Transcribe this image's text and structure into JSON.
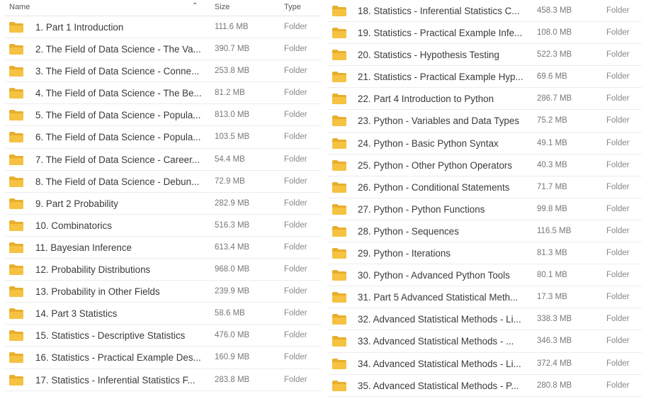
{
  "header": {
    "name": "Name",
    "size": "Size",
    "type": "Type",
    "sort_icon": "chevron-up-icon"
  },
  "colors": {
    "folder": "#F5C242",
    "folder_tab": "#E8AE2C"
  },
  "left_rows": [
    {
      "name": "1. Part 1 Introduction",
      "size": "111.6 MB",
      "type": "Folder"
    },
    {
      "name": "2. The Field of Data Science - The Va...",
      "size": "390.7 MB",
      "type": "Folder"
    },
    {
      "name": "3. The Field of Data Science - Conne...",
      "size": "253.8 MB",
      "type": "Folder"
    },
    {
      "name": "4. The Field of Data Science - The Be...",
      "size": "81.2 MB",
      "type": "Folder"
    },
    {
      "name": "5. The Field of Data Science - Popula...",
      "size": "813.0 MB",
      "type": "Folder"
    },
    {
      "name": "6. The Field of Data Science - Popula...",
      "size": "103.5 MB",
      "type": "Folder"
    },
    {
      "name": "7. The Field of Data Science - Career...",
      "size": "54.4 MB",
      "type": "Folder"
    },
    {
      "name": "8. The Field of Data Science - Debun...",
      "size": "72.9 MB",
      "type": "Folder"
    },
    {
      "name": "9. Part 2 Probability",
      "size": "282.9 MB",
      "type": "Folder"
    },
    {
      "name": "10. Combinatorics",
      "size": "516.3 MB",
      "type": "Folder"
    },
    {
      "name": "11. Bayesian Inference",
      "size": "613.4 MB",
      "type": "Folder"
    },
    {
      "name": "12. Probability Distributions",
      "size": "968.0 MB",
      "type": "Folder"
    },
    {
      "name": "13. Probability in Other Fields",
      "size": "239.9 MB",
      "type": "Folder"
    },
    {
      "name": "14. Part 3 Statistics",
      "size": "58.6 MB",
      "type": "Folder"
    },
    {
      "name": "15. Statistics - Descriptive Statistics",
      "size": "476.0 MB",
      "type": "Folder"
    },
    {
      "name": "16. Statistics - Practical Example Des...",
      "size": "160.9 MB",
      "type": "Folder"
    },
    {
      "name": "17. Statistics - Inferential Statistics F...",
      "size": "283.8 MB",
      "type": "Folder"
    }
  ],
  "right_rows": [
    {
      "name": "18. Statistics - Inferential Statistics C...",
      "size": "458.3 MB",
      "type": "Folder"
    },
    {
      "name": "19. Statistics - Practical Example Infe...",
      "size": "108.0 MB",
      "type": "Folder"
    },
    {
      "name": "20. Statistics - Hypothesis Testing",
      "size": "522.3 MB",
      "type": "Folder"
    },
    {
      "name": "21. Statistics - Practical Example Hyp...",
      "size": "69.6 MB",
      "type": "Folder"
    },
    {
      "name": "22. Part 4 Introduction to Python",
      "size": "286.7 MB",
      "type": "Folder"
    },
    {
      "name": "23. Python - Variables and Data Types",
      "size": "75.2 MB",
      "type": "Folder"
    },
    {
      "name": "24. Python - Basic Python Syntax",
      "size": "49.1 MB",
      "type": "Folder"
    },
    {
      "name": "25. Python - Other Python Operators",
      "size": "40.3 MB",
      "type": "Folder"
    },
    {
      "name": "26. Python - Conditional Statements",
      "size": "71.7 MB",
      "type": "Folder"
    },
    {
      "name": "27. Python - Python Functions",
      "size": "99.8 MB",
      "type": "Folder"
    },
    {
      "name": "28. Python - Sequences",
      "size": "116.5 MB",
      "type": "Folder"
    },
    {
      "name": "29. Python - Iterations",
      "size": "81.3 MB",
      "type": "Folder"
    },
    {
      "name": "30. Python - Advanced Python Tools",
      "size": "80.1 MB",
      "type": "Folder"
    },
    {
      "name": "31. Part 5 Advanced Statistical Meth...",
      "size": "17.3 MB",
      "type": "Folder"
    },
    {
      "name": "32. Advanced Statistical Methods - Li...",
      "size": "338.3 MB",
      "type": "Folder"
    },
    {
      "name": "33. Advanced Statistical Methods - ...",
      "size": "346.3 MB",
      "type": "Folder"
    },
    {
      "name": "34. Advanced Statistical Methods - Li...",
      "size": "372.4 MB",
      "type": "Folder"
    },
    {
      "name": "35. Advanced Statistical Methods - P...",
      "size": "280.8 MB",
      "type": "Folder"
    }
  ]
}
